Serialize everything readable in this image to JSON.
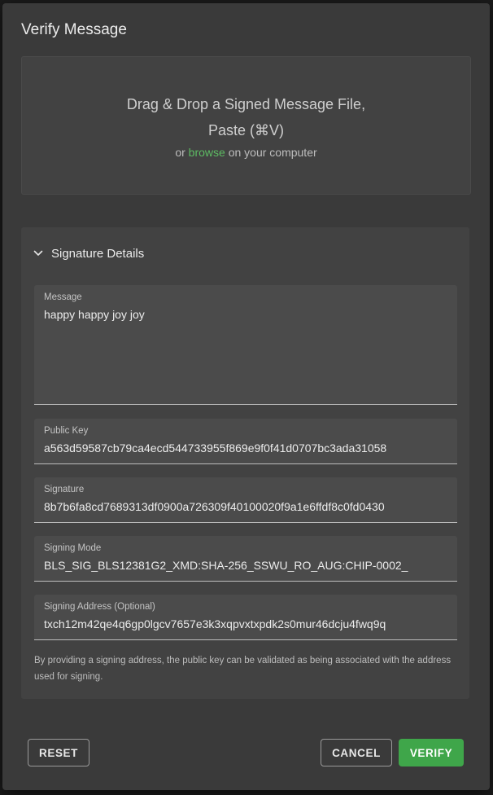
{
  "dialog": {
    "title": "Verify Message"
  },
  "dropzone": {
    "line1": "Drag & Drop a Signed Message File,",
    "line2": "Paste (⌘V)",
    "prefix": "or ",
    "link": "browse",
    "suffix": " on your computer",
    "accent_color": "#5dbb63"
  },
  "details": {
    "title": "Signature Details",
    "icon": "chevron-down-icon",
    "fields": {
      "message": {
        "label": "Message",
        "value": "happy happy joy joy"
      },
      "public_key": {
        "label": "Public Key",
        "value": "a563d59587cb79ca4ecd544733955f869e9f0f41d0707bc3ada31058"
      },
      "signature": {
        "label": "Signature",
        "value": "8b7b6fa8cd7689313df0900a726309f40100020f9a1e6ffdf8c0fd0430"
      },
      "signing_mode": {
        "label": "Signing Mode",
        "value": "BLS_SIG_BLS12381G2_XMD:SHA-256_SSWU_RO_AUG:CHIP-0002_"
      },
      "signing_address": {
        "label": "Signing Address (Optional)",
        "value": "txch12m42qe4q6gp0lgcv7657e3k3xqpvxtxpdk2s0mur46dcju4fwq9q"
      }
    },
    "helper_text": "By providing a signing address, the public key can be validated as being associated with the address used for signing."
  },
  "actions": {
    "reset_label": "RESET",
    "cancel_label": "CANCEL",
    "verify_label": "VERIFY",
    "primary_color": "#3fa64a"
  }
}
